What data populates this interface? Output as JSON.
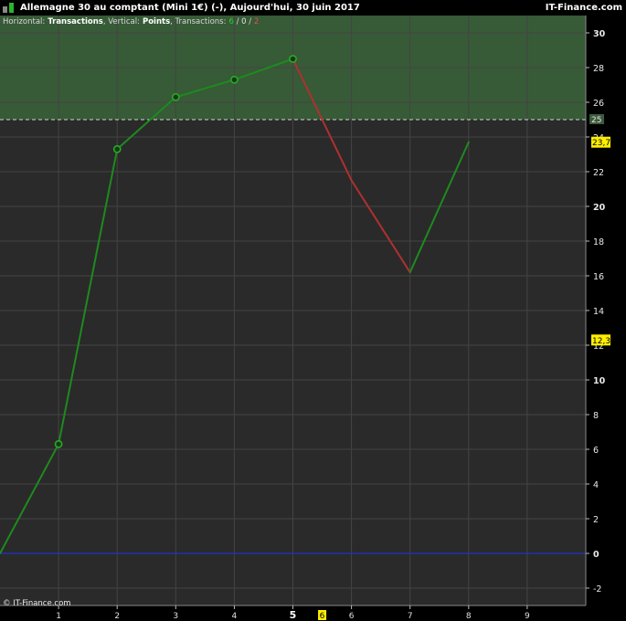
{
  "header": {
    "title": "Allemagne 30 au comptant (Mini 1€) (-), Aujourd'hui, 30 juin 2017",
    "brand": "IT-Finance.com"
  },
  "info": {
    "horizontal_label": "Horizontal:",
    "horizontal_value": "Transactions",
    "vertical_label": ", Vertical:",
    "vertical_value": "Points",
    "transactions_label": ", Transactions:",
    "wins": "6",
    "sep1": " / ",
    "neutral": "0",
    "sep2": " / ",
    "losses": "2"
  },
  "copyright": "© IT-Finance.com",
  "colors": {
    "background": "#2a2a2a",
    "zone": "#375a37",
    "win": "#1e8a1e",
    "loss": "#b03030",
    "zero_line": "#2030c8",
    "grid": "#444444",
    "marker_fill": "#143c14"
  },
  "chart_data": {
    "type": "line",
    "x": [
      0,
      1,
      2,
      3,
      4,
      5,
      6,
      7,
      8
    ],
    "y": [
      0,
      6.3,
      23.3,
      26.3,
      27.3,
      28.5,
      21.5,
      16.2,
      23.7
    ],
    "segment_results": [
      "win",
      "win",
      "win",
      "win",
      "win",
      "loss",
      "loss",
      "win"
    ],
    "markers": [
      1,
      2,
      3,
      4,
      5
    ],
    "xlim": [
      0,
      10
    ],
    "ylim": [
      -3,
      31
    ],
    "x_ticks": [
      "1",
      "2",
      "3",
      "4",
      "5",
      "6",
      "7",
      "8",
      "9"
    ],
    "x_tick_bold": "5",
    "x_highlight": "6",
    "y_ticks": [
      "30",
      "28",
      "26",
      "24",
      "22",
      "20",
      "18",
      "16",
      "14",
      "12",
      "10",
      "8",
      "6",
      "4",
      "2",
      "0",
      "-2"
    ],
    "zone_from": 25,
    "zone_label": "25",
    "tags": [
      "23,7",
      "12,3"
    ],
    "grid": true
  }
}
